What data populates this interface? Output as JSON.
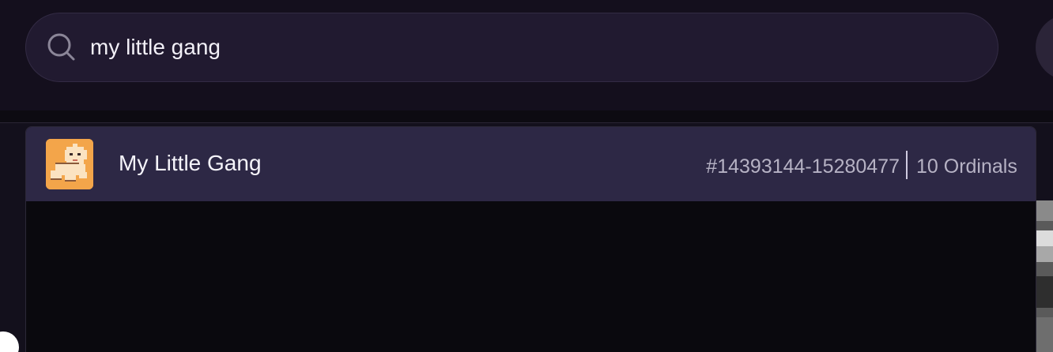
{
  "search": {
    "value": "my little gang",
    "icon": "search-icon"
  },
  "results": [
    {
      "name": "My Little Gang",
      "inscription_range": "#14393144-15280477",
      "count_label": "10 Ordinals",
      "avatar_color": "#f3a54a"
    }
  ],
  "colors": {
    "background": "#13101c",
    "search_fill": "#211a30",
    "result_highlight": "#2d2845",
    "panel_background": "#0a090e"
  }
}
